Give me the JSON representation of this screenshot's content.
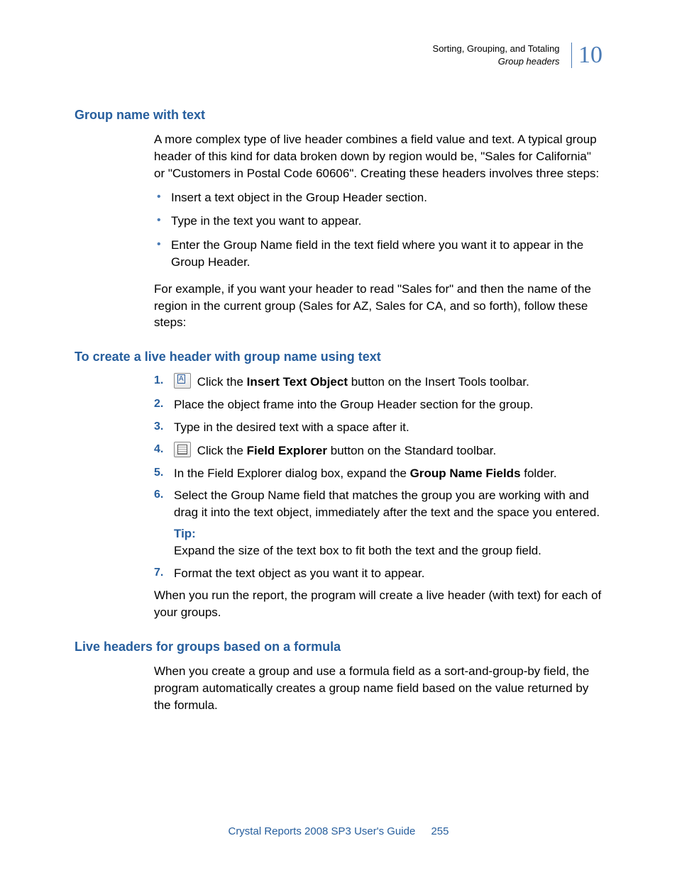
{
  "header": {
    "breadcrumb_main": "Sorting, Grouping, and Totaling",
    "breadcrumb_sub": "Group headers",
    "chapter_number": "10"
  },
  "section1": {
    "title": "Group name with text",
    "intro": "A more complex type of live header combines a field value and text. A typical group header of this kind for data broken down by region would be, \"Sales for California\" or \"Customers in Postal Code 60606\". Creating these headers involves three steps:",
    "bullets": [
      "Insert a text object in the Group Header section.",
      "Type in the text you want to appear.",
      "Enter the Group Name field in the text field where you want it to appear in the Group Header."
    ],
    "followup": "For example, if you want your header to read \"Sales for\" and then the name of the region in the current group (Sales for AZ, Sales for CA, and so forth), follow these steps:"
  },
  "section2": {
    "title": "To create a live header with group name using text",
    "step1_pre": " Click the ",
    "step1_bold": "Insert Text Object",
    "step1_post": " button on the Insert Tools toolbar.",
    "step2": "Place the object frame into the Group Header section for the group.",
    "step3": "Type in the desired text with a space after it.",
    "step4_pre": " Click the ",
    "step4_bold": "Field Explorer",
    "step4_post": " button on the Standard toolbar.",
    "step5_pre": "In the Field Explorer dialog box, expand the ",
    "step5_bold": "Group Name Fields",
    "step5_post": " folder.",
    "step6": "Select the Group Name field that matches the group you are working with and drag it into the text object, immediately after the text and the space you entered.",
    "tip_label": "Tip:",
    "tip_body": "Expand the size of the text box to fit both the text and the group field.",
    "step7": "Format the text object as you want it to appear.",
    "closing": "When you run the report, the program will create a live header (with text) for each of your groups."
  },
  "section3": {
    "title": "Live headers for groups based on a formula",
    "body": "When you create a group and use a formula field as a sort-and-group-by field, the program automatically creates a group name field based on the value returned by the formula."
  },
  "footer": {
    "guide": "Crystal Reports 2008 SP3 User's Guide",
    "page": "255"
  }
}
